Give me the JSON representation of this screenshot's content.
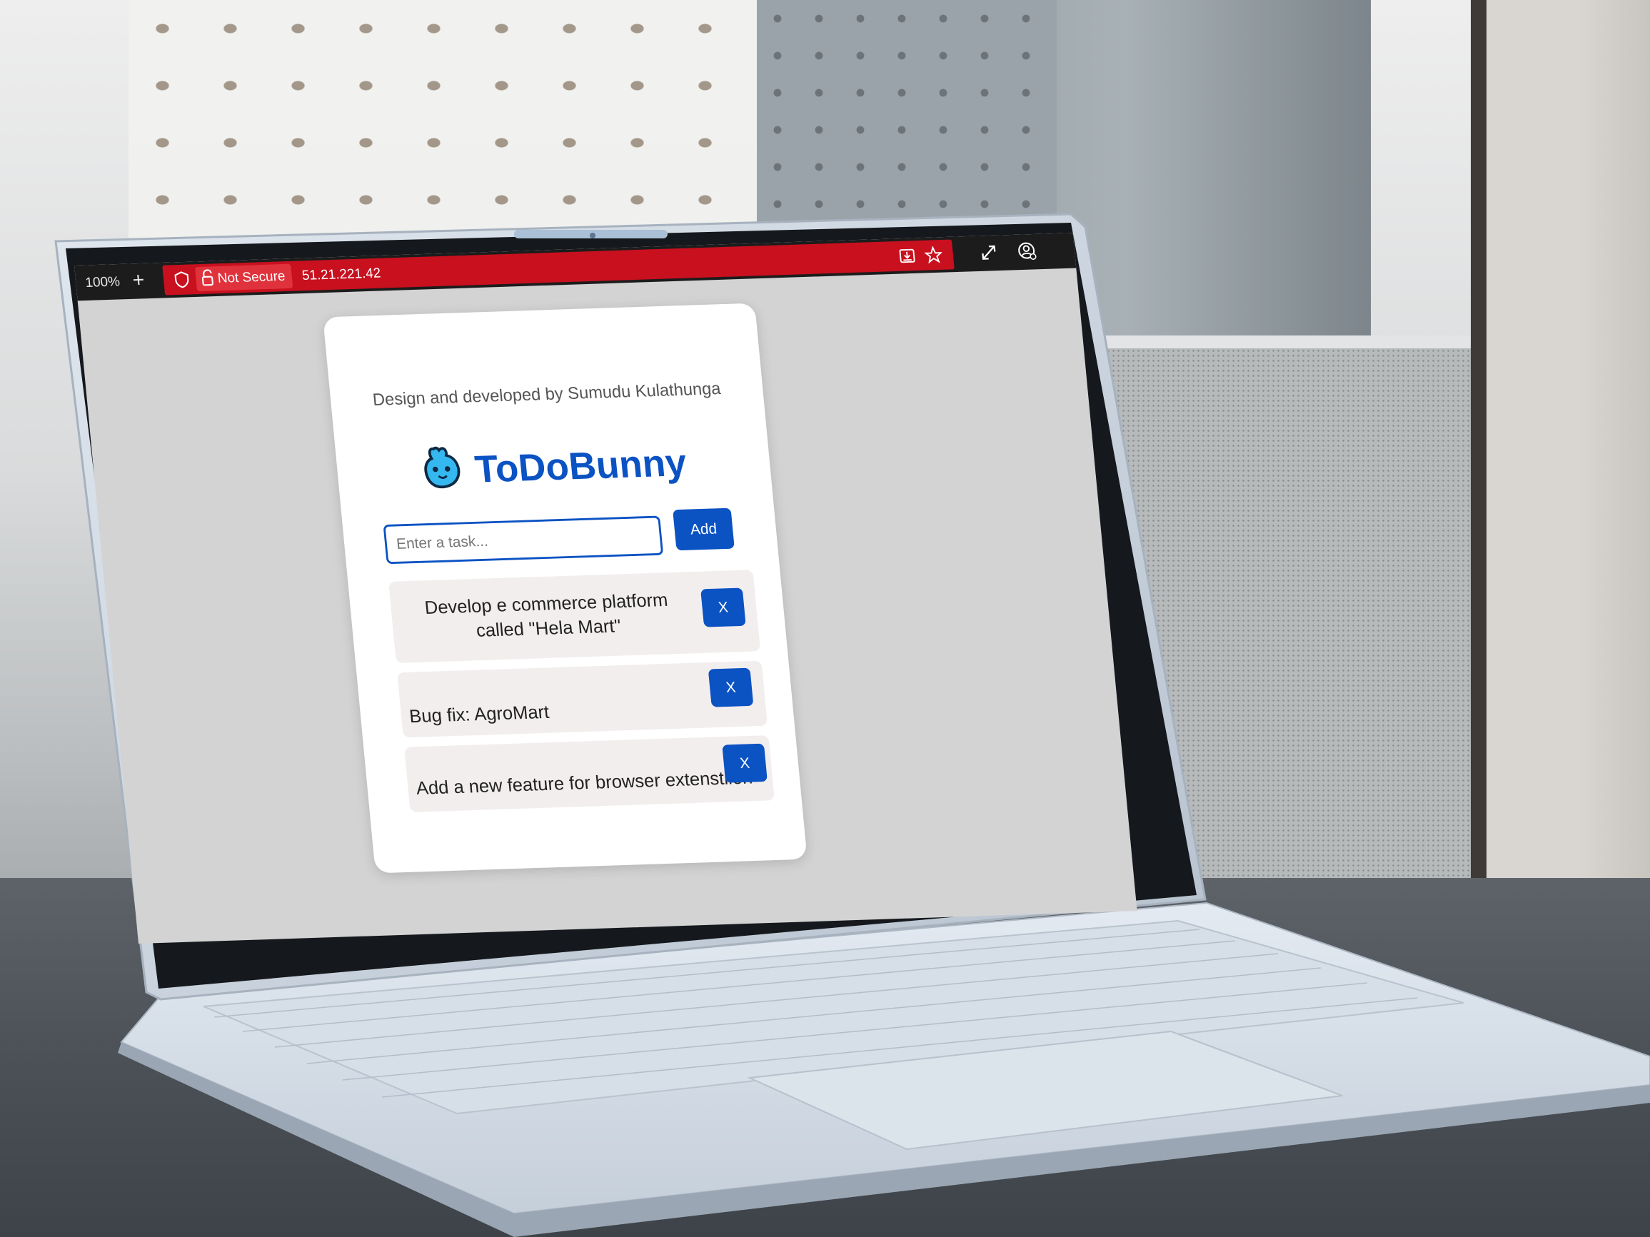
{
  "browser": {
    "zoom": "100%",
    "new_tab_glyph": "+",
    "security_label": "Not Secure",
    "address": "51.21.221.42",
    "toolbar_icons": [
      "shield-icon",
      "unlock-icon",
      "download-icon",
      "star-icon",
      "expand-icon",
      "profile-icon"
    ],
    "bar_color": "#c8101f"
  },
  "app": {
    "credit": "Design and developed by Sumudu Kulathunga",
    "title": "ToDoBunny",
    "logo_icon": "bunny-logo-icon",
    "input_placeholder": "Enter a task...",
    "add_label": "Add",
    "tasks": [
      {
        "text": "Develop e commerce platform called \"Hela Mart\"",
        "delete_label": "X"
      },
      {
        "text": "Bug fix: AgroMart",
        "delete_label": "X"
      },
      {
        "text": "Add a new feature for browser extenstiion",
        "delete_label": "X"
      }
    ],
    "accent_color": "#0b52c3",
    "page_background": "#d3d3d3"
  }
}
